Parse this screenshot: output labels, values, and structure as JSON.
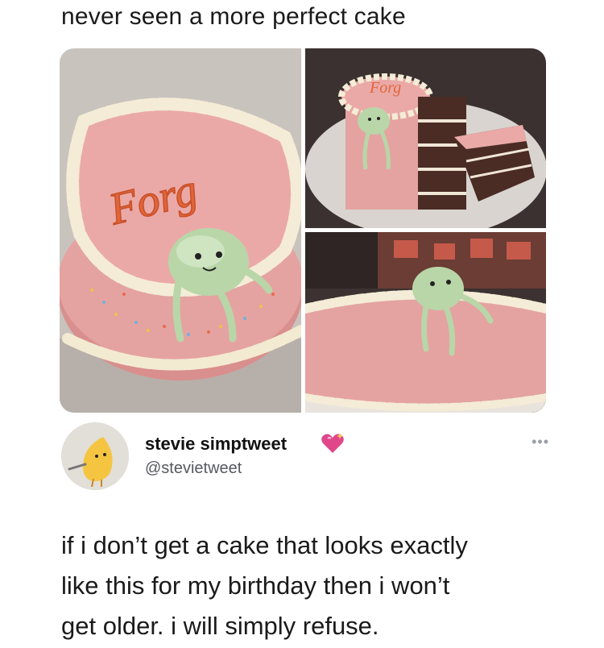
{
  "caption": "never seen a more perfect cake",
  "photos": {
    "cake_lettering": "Forg",
    "icons": [
      "cake-photo-top-view",
      "cake-photo-sliced",
      "cake-photo-side-view"
    ]
  },
  "tweet": {
    "display_name": "stevie simptweet",
    "handle": "@stevietweet",
    "badge_icon": "sparkling-heart-icon",
    "more_icon": "more-options-icon",
    "more_glyph": "•••",
    "text_lines": [
      "if i don’t get a cake that looks exactly",
      "like this for my birthday then i won’t",
      "get older. i will simply refuse."
    ]
  },
  "colors": {
    "frosting_pink": "#e9a7a5",
    "frog_green": "#b9d6a8",
    "lettering_orange": "#e0663a",
    "heart_pink": "#e0478b"
  }
}
